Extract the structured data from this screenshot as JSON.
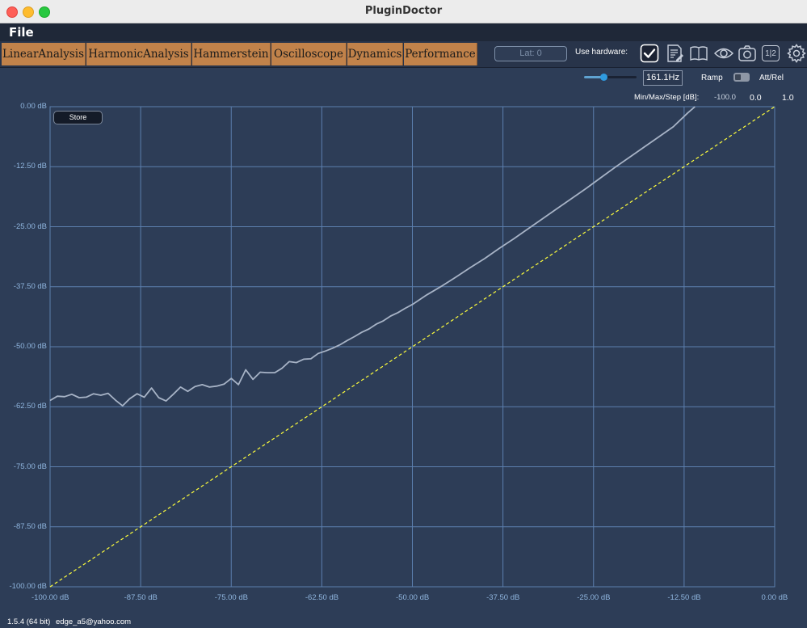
{
  "window": {
    "title": "PluginDoctor"
  },
  "menu": {
    "file": "File"
  },
  "tabs": [
    "LinearAnalysis",
    "HarmonicAnalysis",
    "Hammerstein",
    "Oscilloscope",
    "Dynamics",
    "Performance"
  ],
  "toolbar": {
    "latency": "Lat: 0",
    "use_hardware_label": "Use hardware:",
    "use_hardware_checked": true,
    "channel_icon_text": "1|2"
  },
  "controls": {
    "frequency": "161.1Hz",
    "frequency_slider_fraction": 0.38,
    "ramp_label": "Ramp",
    "att_rel_label": "Att/Rel",
    "min_max_step_label": "Min/Max/Step [dB]:",
    "min": "-100.0",
    "max": "0.0",
    "step": "1.0"
  },
  "store_label": "Store",
  "footer": {
    "version": "1.5.4 (64 bit)",
    "user": "edge_a5@yahoo.com"
  },
  "colors": {
    "accent_tab": "#c1824a",
    "background": "#2d3d57",
    "curve": "#a7b3c6",
    "reference_line": "#ffff3c",
    "grid": "#5c7fae"
  },
  "chart_data": {
    "type": "line",
    "xlim": [
      -100,
      0
    ],
    "ylim": [
      -100,
      0
    ],
    "x_ticks": [
      "-100.00 dB",
      "-87.50 dB",
      "-75.00 dB",
      "-62.50 dB",
      "-50.00 dB",
      "-37.50 dB",
      "-25.00 dB",
      "-12.50 dB",
      "0.00 dB"
    ],
    "y_ticks": [
      "0.00 dB",
      "-12.50 dB",
      "-25.00 dB",
      "-37.50 dB",
      "-50.00 dB",
      "-62.50 dB",
      "-75.00 dB",
      "-87.50 dB",
      "-100.00 dB"
    ],
    "grid": true,
    "series": [
      {
        "x": [
          -100,
          -99,
          -98,
          -97,
          -96,
          -95,
          -94,
          -93,
          -92,
          -91,
          -90,
          -89,
          -88,
          -87,
          -86,
          -85,
          -84,
          -83,
          -82,
          -81,
          -80,
          -79,
          -78,
          -77,
          -76,
          -75,
          -74,
          -73,
          -72,
          -71,
          -70,
          -69,
          -68,
          -67,
          -66,
          -65,
          -64,
          -63,
          -62,
          -61,
          -60,
          -59,
          -58,
          -57,
          -56,
          -55,
          -54,
          -53,
          -52,
          -51,
          -50,
          -48,
          -46,
          -44,
          -42,
          -40,
          -38,
          -36,
          -34,
          -32,
          -30,
          -28,
          -26,
          -24,
          -22,
          -20,
          -18,
          -16,
          -14,
          -12,
          -11
        ],
        "y": [
          -61.2,
          -60.3,
          -60.4,
          -59.9,
          -60.6,
          -60.5,
          -59.8,
          -60.1,
          -59.7,
          -61.1,
          -62.3,
          -60.8,
          -59.8,
          -60.5,
          -58.6,
          -60.6,
          -61.3,
          -59.9,
          -58.4,
          -59.3,
          -58.3,
          -57.9,
          -58.4,
          -58.2,
          -57.8,
          -56.6,
          -57.9,
          -54.8,
          -56.8,
          -55.3,
          -55.4,
          -55.4,
          -54.5,
          -53.1,
          -53.3,
          -52.6,
          -52.5,
          -51.4,
          -50.9,
          -50.3,
          -49.6,
          -48.7,
          -47.9,
          -47.0,
          -46.3,
          -45.3,
          -44.6,
          -43.6,
          -42.9,
          -42.0,
          -41.2,
          -39.2,
          -37.4,
          -35.5,
          -33.5,
          -31.6,
          -29.5,
          -27.5,
          -25.4,
          -23.3,
          -21.2,
          -19.1,
          -17.0,
          -14.8,
          -12.6,
          -10.5,
          -8.4,
          -6.3,
          -4.2,
          -1.3,
          0.0
        ]
      },
      {
        "x": [
          -100,
          0
        ],
        "y": [
          -100,
          0
        ]
      }
    ]
  }
}
